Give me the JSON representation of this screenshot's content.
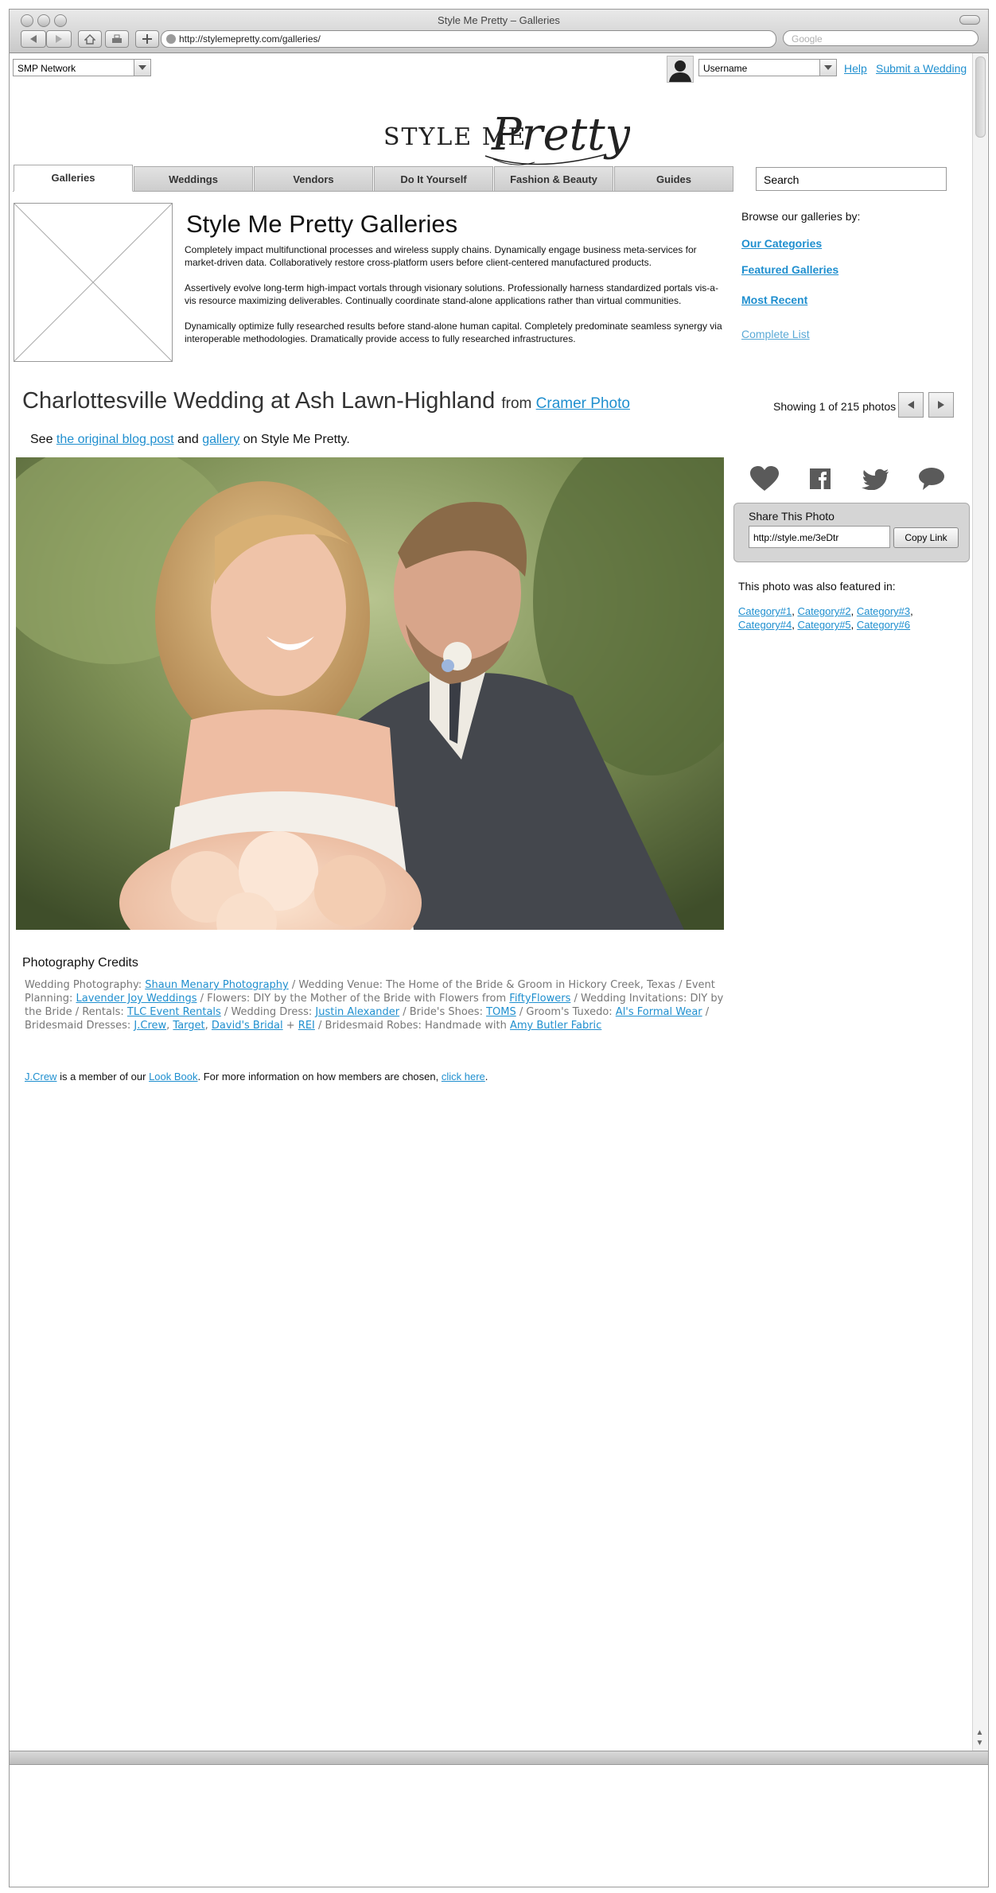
{
  "browser": {
    "title": "Style Me Pretty – Galleries",
    "url": "http://stylemepretty.com/galleries/",
    "search_placeholder": "Google"
  },
  "topbar": {
    "network_select": "SMP Network",
    "username_select": "Username",
    "help": "Help",
    "submit_wedding": "Submit a Wedding"
  },
  "logo": {
    "text_left": "STYLE ME",
    "text_script": "Pretty"
  },
  "tabs": [
    "Galleries",
    "Weddings",
    "Vendors",
    "Do It Yourself",
    "Fashion & Beauty",
    "Guides"
  ],
  "search": {
    "value": "Search"
  },
  "intro": {
    "title": "Style Me Pretty Galleries",
    "paragraphs": [
      "Completely impact multifunctional processes and wireless supply chains. Dynamically engage business meta-services for market-driven data. Collaboratively restore cross-platform users before client-centered manufactured products.",
      "Assertively evolve long-term high-impact vortals through visionary solutions. Professionally harness standardized portals vis-a-vis resource maximizing deliverables. Continually coordinate stand-alone applications rather than virtual communities.",
      "Dynamically optimize fully researched results before stand-alone human capital. Completely predominate seamless synergy via interoperable methodologies. Dramatically provide access to fully researched infrastructures."
    ]
  },
  "browse": {
    "label": "Browse our galleries by:",
    "links": [
      "Our Categories",
      "Featured Galleries",
      "Most Recent"
    ],
    "complete_list": "Complete List"
  },
  "photo": {
    "title": "Charlottesville Wedding at Ash Lawn-Highland",
    "from": "from",
    "photographer": "Cramer Photo",
    "showing": "Showing 1 of 215 photos",
    "see_prefix": "See",
    "blog_link": "the original blog post",
    "and": "and",
    "gallery_link": "gallery",
    "see_suffix": "on Style Me Pretty."
  },
  "share": {
    "title": "Share This Photo",
    "url": "http://style.me/3eDtr",
    "copy": "Copy Link",
    "featured_label": "This photo was also featured in:",
    "categories": [
      "Category#1",
      "Category#2",
      "Category#3",
      "Category#4",
      "Category#5",
      "Category#6"
    ]
  },
  "credits": {
    "title": "Photography Credits",
    "t1": "Wedding Photography: ",
    "l1": "Shaun Menary Photography",
    "t2": " / Wedding Venue: The Home of the Bride & Groom in Hickory Creek, Texas / Event Planning: ",
    "l2": "Lavender Joy Weddings",
    "t3": " / Flowers: DIY by the Mother of the Bride with Flowers from ",
    "l3": "FiftyFlowers",
    "t4": " / Wedding Invitations: DIY by the Bride / Rentals: ",
    "l4": "TLC Event Rentals",
    "t5": " / Wedding Dress: ",
    "l5": "Justin Alexander",
    "t6": " / Bride's Shoes: ",
    "l6": "TOMS",
    "t7": " / Groom's Tuxedo: ",
    "l7": "Al's Formal Wear",
    "t8": " / Bridesmaid Dresses: ",
    "l8": "J.Crew",
    "t9": ", ",
    "l9": "Target",
    "t10": ", ",
    "l10": "David's Bridal",
    "t11": " + ",
    "l11": "REI",
    "t12": " / Bridesmaid Robes: Handmade with ",
    "l12": "Amy Butler Fabric"
  },
  "member": {
    "brand": "J.Crew",
    "text1": " is a member of our ",
    "lookbook": "Look Book",
    "text2": ". For more information on how members are chosen, ",
    "click": "click here",
    "text3": "."
  }
}
